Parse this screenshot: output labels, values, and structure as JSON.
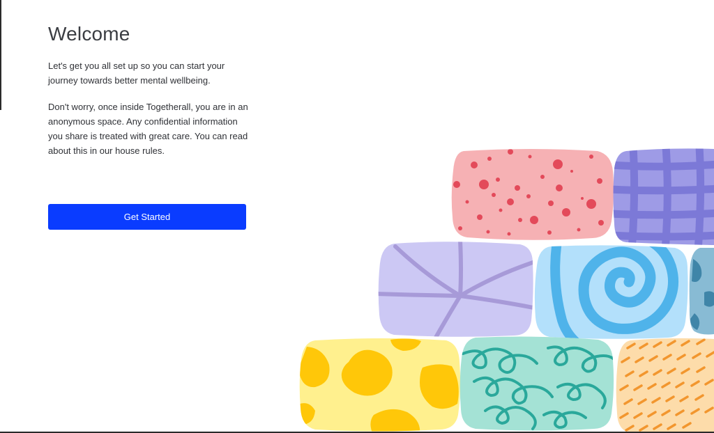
{
  "welcome": {
    "title": "Welcome",
    "intro": "Let's get you all set up so you can start your journey towards better mental wellbeing.",
    "privacy": "Don't worry, once inside Togetherall, you are in an anonymous space. Any confidential information you share is treated with great care. You can read about this in our house rules.",
    "get_started_label": "Get Started"
  },
  "colors": {
    "accent": "#0a3cff",
    "pink": "#f6b1b4",
    "pink_dot": "#e34a5a",
    "purple": "#9e9be6",
    "purple_grid": "#7b78d6",
    "lavender": "#ccc8f4",
    "lavender_line": "#a79ad8",
    "blue": "#b3e0fb",
    "blue_swirl": "#4fb3ea",
    "yellow": "#fff08e",
    "yellow_spot": "#ffc709",
    "teal": "#a4e2d5",
    "teal_loop": "#2aa89b",
    "peach": "#fddcaa",
    "peach_dash": "#f2962e"
  }
}
